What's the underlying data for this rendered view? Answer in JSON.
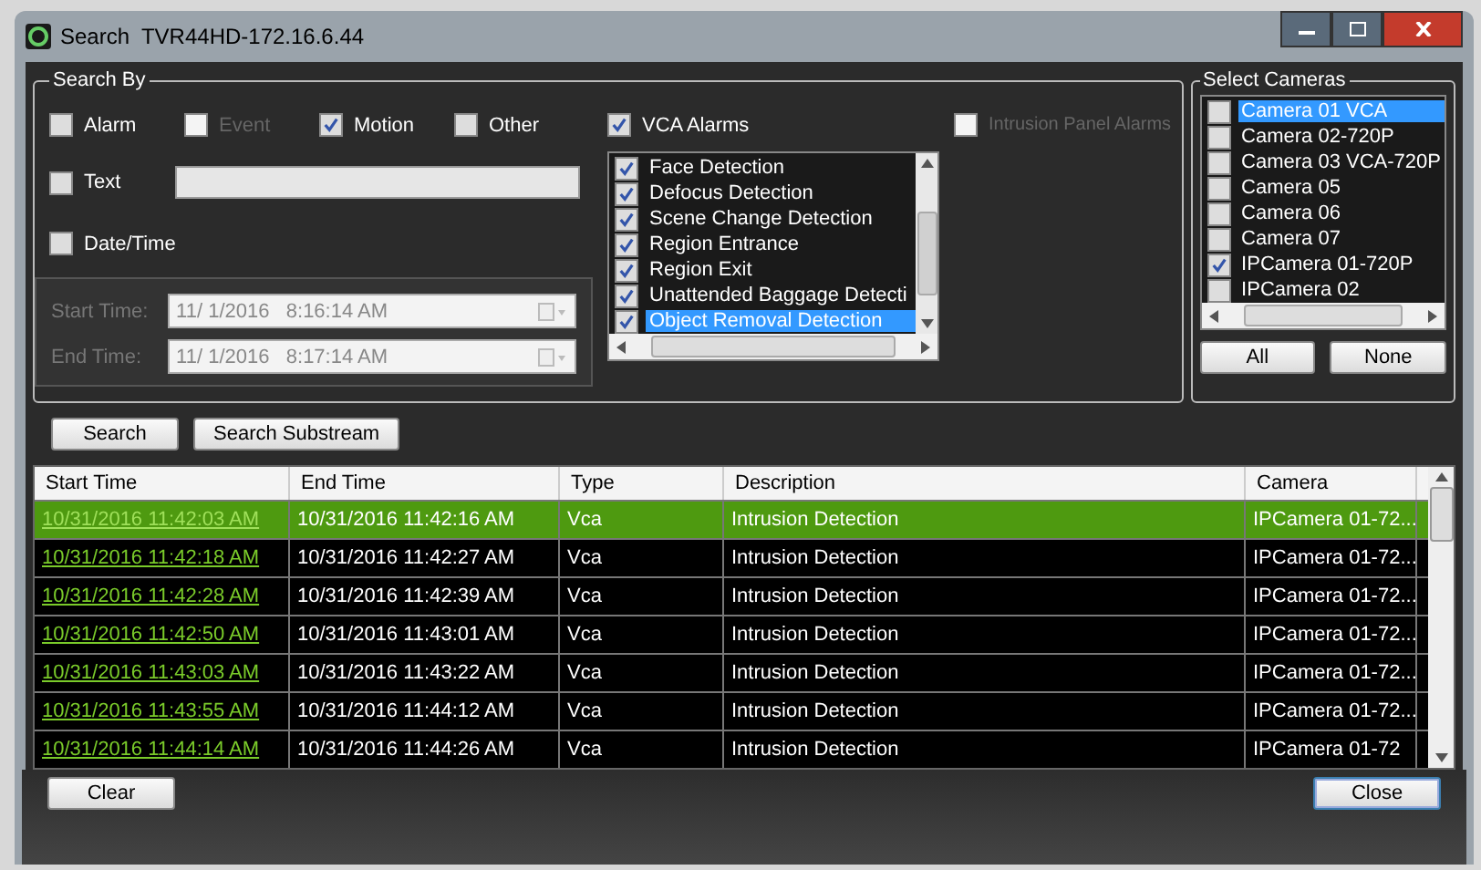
{
  "window": {
    "title": "Search  TVR44HD-172.16.6.44"
  },
  "search_by": {
    "title": "Search By",
    "filters": [
      {
        "label": "Alarm",
        "checked": false,
        "disabled": false
      },
      {
        "label": "Event",
        "checked": false,
        "disabled": true
      },
      {
        "label": "Motion",
        "checked": true,
        "disabled": false
      },
      {
        "label": "Other",
        "checked": false,
        "disabled": false
      }
    ],
    "text_filter": {
      "label": "Text",
      "checked": false
    },
    "date_time": {
      "label": "Date/Time",
      "checked": false,
      "fields": [
        {
          "label": "Start Time:",
          "value": "11/ 1/2016   8:16:14 AM",
          "disabled": true
        },
        {
          "label": "End Time:",
          "value": "11/ 1/2016   8:17:14 AM",
          "disabled": true
        }
      ]
    },
    "vca_alarms": {
      "label": "VCA Alarms",
      "checked": true,
      "items": [
        {
          "label": "Face Detection",
          "checked": true,
          "selected": false
        },
        {
          "label": "Defocus Detection",
          "checked": true,
          "selected": false
        },
        {
          "label": "Scene Change Detection",
          "checked": true,
          "selected": false
        },
        {
          "label": "Region Entrance",
          "checked": true,
          "selected": false
        },
        {
          "label": "Region Exit",
          "checked": true,
          "selected": false
        },
        {
          "label": "Unattended Baggage Detecti",
          "checked": true,
          "selected": false
        },
        {
          "label": "Object Removal Detection",
          "checked": true,
          "selected": true
        }
      ]
    },
    "intrusion_panel": {
      "label": "Intrusion Panel Alarms",
      "checked": false,
      "disabled": true
    }
  },
  "select_cameras": {
    "title": "Select Cameras",
    "items": [
      {
        "label": "Camera 01 VCA",
        "checked": false,
        "selected": true
      },
      {
        "label": "Camera 02-720P",
        "checked": false,
        "selected": false
      },
      {
        "label": "Camera 03 VCA-720P",
        "checked": false,
        "selected": false
      },
      {
        "label": "Camera 05",
        "checked": false,
        "selected": false
      },
      {
        "label": "Camera 06",
        "checked": false,
        "selected": false
      },
      {
        "label": "Camera 07",
        "checked": false,
        "selected": false
      },
      {
        "label": "IPCamera 01-720P",
        "checked": true,
        "selected": false
      },
      {
        "label": "IPCamera 02",
        "checked": false,
        "selected": false
      }
    ],
    "buttons": [
      "All",
      "None"
    ]
  },
  "search_buttons": [
    "Search",
    "Search Substream"
  ],
  "table": {
    "columns": [
      "Start Time",
      "End Time",
      "Type",
      "Description",
      "Camera"
    ],
    "rows": [
      {
        "selected": true,
        "cells": [
          "10/31/2016 11:42:03 AM",
          "10/31/2016 11:42:16 AM",
          "Vca",
          "Intrusion Detection",
          "IPCamera 01-72..."
        ]
      },
      {
        "selected": false,
        "cells": [
          "10/31/2016 11:42:18 AM",
          "10/31/2016 11:42:27 AM",
          "Vca",
          "Intrusion Detection",
          "IPCamera 01-72..."
        ]
      },
      {
        "selected": false,
        "cells": [
          "10/31/2016 11:42:28 AM",
          "10/31/2016 11:42:39 AM",
          "Vca",
          "Intrusion Detection",
          "IPCamera 01-72..."
        ]
      },
      {
        "selected": false,
        "cells": [
          "10/31/2016 11:42:50 AM",
          "10/31/2016 11:43:01 AM",
          "Vca",
          "Intrusion Detection",
          "IPCamera 01-72..."
        ]
      },
      {
        "selected": false,
        "cells": [
          "10/31/2016 11:43:03 AM",
          "10/31/2016 11:43:22 AM",
          "Vca",
          "Intrusion Detection",
          "IPCamera 01-72..."
        ]
      },
      {
        "selected": false,
        "cells": [
          "10/31/2016 11:43:55 AM",
          "10/31/2016 11:44:12 AM",
          "Vca",
          "Intrusion Detection",
          "IPCamera 01-72..."
        ]
      },
      {
        "selected": false,
        "cells": [
          "10/31/2016 11:44:14 AM",
          "10/31/2016 11:44:26 AM",
          "Vca",
          "Intrusion Detection",
          "IPCamera 01-72"
        ]
      }
    ]
  },
  "bottom_buttons": [
    "Clear",
    "Close"
  ]
}
